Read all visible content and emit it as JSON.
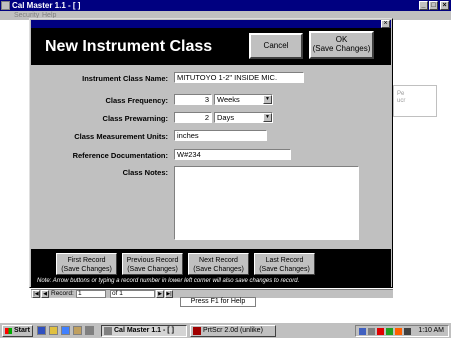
{
  "app": {
    "title": "Cal Master 1.1 - [ ]",
    "menu": [
      "Security",
      "Help"
    ]
  },
  "background_panel": {
    "text": [
      "Pe",
      "ucr"
    ]
  },
  "dialog": {
    "title": "New Instrument Class",
    "close_glyph": "×",
    "cancel_label": "Cancel",
    "ok_label": "OK",
    "ok_sublabel": "(Save Changes)",
    "fields": {
      "class_name": {
        "label": "Instrument Class Name:",
        "value": "MITUTOYO 1-2\" INSIDE MIC."
      },
      "frequency": {
        "label": "Class Frequency:",
        "value": "3",
        "unit": "Weeks"
      },
      "prewarning": {
        "label": "Class Prewarning:",
        "value": "2",
        "unit": "Days"
      },
      "measurement_units": {
        "label": "Class Measurement Units:",
        "value": "inches"
      },
      "reference_doc": {
        "label": "Reference Documentation:",
        "value": "W#234"
      },
      "notes": {
        "label": "Class Notes:",
        "value": ""
      }
    },
    "nav_buttons": [
      {
        "label": "First Record",
        "sublabel": "(Save Changes)"
      },
      {
        "label": "Previous Record",
        "sublabel": "(Save Changes)"
      },
      {
        "label": "Next Record",
        "sublabel": "(Save Changes)"
      },
      {
        "label": "Last Record",
        "sublabel": "(Save Changes)"
      }
    ],
    "footer_note": "Note: Arrow buttons or typing a record number in lower left corner will also save changes to record."
  },
  "record_nav": {
    "record_label": "Record:",
    "record_value": "1",
    "of_text": "of 1"
  },
  "status_text": "Press F1 for Help",
  "taskbar": {
    "start_label": "Start",
    "tasks": [
      {
        "label": "Cal Master 1.1 - [ ]",
        "active": true
      },
      {
        "label": "PrtScr 2.0d (unlike)",
        "active": false
      }
    ],
    "clock": "1:10 AM"
  },
  "colors": {
    "titlebar": "#000080",
    "dialog_header": "#000000",
    "face": "#c0c0c0"
  }
}
